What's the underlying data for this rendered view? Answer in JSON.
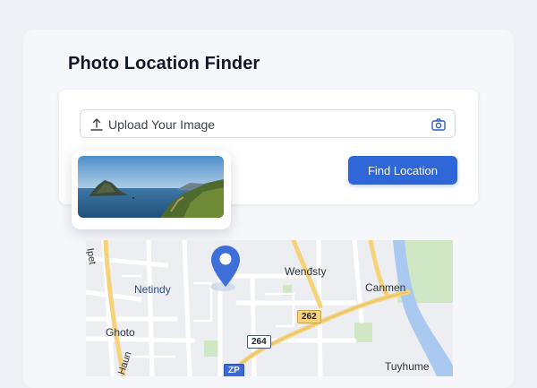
{
  "app": {
    "title": "Photo Location Finder"
  },
  "upload": {
    "placeholder": "Upload Your Image",
    "icon": "upload-icon",
    "camera_icon": "camera-icon"
  },
  "actions": {
    "find_location": "Find Location"
  },
  "map": {
    "labels": {
      "top_left_street": "Ipet",
      "netindy": "Netindy",
      "wendsty": "Wenđsty",
      "canmen": "Canmen",
      "ghoto": "Ghoto",
      "haun": "Haun",
      "tuyhume": "Tuyhume"
    },
    "shields": {
      "route_262": "262",
      "route_264": "264",
      "zp": "ZP"
    }
  },
  "colors": {
    "accent": "#2f67d8",
    "pin": "#3f6fd9",
    "highway": "#f6d37a",
    "water": "#a9c9f0",
    "park": "#cfe7c5"
  }
}
